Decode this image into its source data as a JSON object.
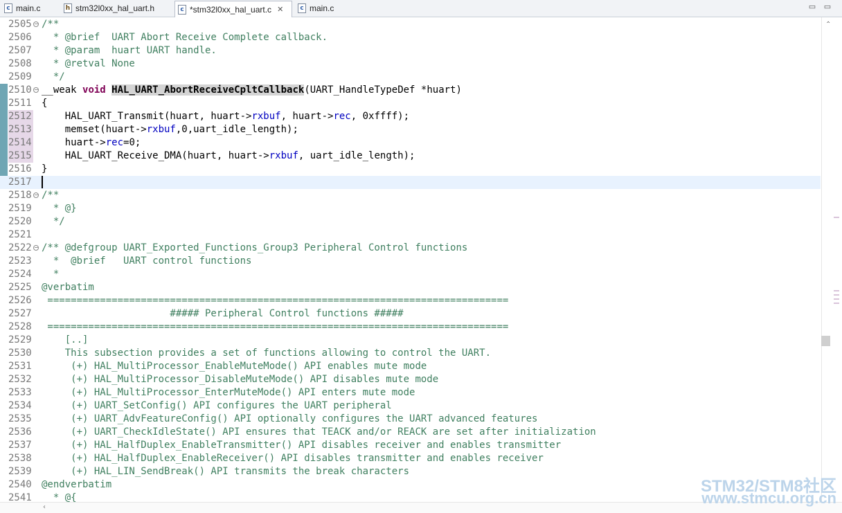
{
  "tabs": [
    {
      "label": "main.c",
      "icon": "c-file-icon",
      "active": false
    },
    {
      "label": "stm32l0xx_hal_uart.h",
      "icon": "h-file-icon",
      "active": false
    },
    {
      "label": "*stm32l0xx_hal_uart.c",
      "icon": "c-file-icon",
      "active": true
    },
    {
      "label": "main.c",
      "icon": "c-file-icon",
      "active": false
    }
  ],
  "window_controls": {
    "minimize": "▭",
    "maximize": "▭"
  },
  "lines": [
    {
      "n": "2505",
      "fold": true,
      "html": "<span class=\"cm\">/**</span>"
    },
    {
      "n": "2506",
      "html": "<span class=\"cm\">  * @brief  UART Abort Receive Complete callback.</span>"
    },
    {
      "n": "2507",
      "html": "<span class=\"cm\">  * @param  huart UART handle.</span>"
    },
    {
      "n": "2508",
      "html": "<span class=\"cm\">  * @retval None</span>"
    },
    {
      "n": "2509",
      "html": "<span class=\"cm\">  */</span>"
    },
    {
      "n": "2510",
      "fold": true,
      "html": "__weak <span class=\"kw\">void</span> <span class=\"hl\">HAL_UART_AbortReceiveCpltCallback</span>(UART_HandleTypeDef *huart)"
    },
    {
      "n": "2511",
      "html": "{"
    },
    {
      "n": "2512",
      "html": "    HAL_UART_Transmit(huart, huart-&gt;<span class=\"fld\">rxbuf</span>, huart-&gt;<span class=\"fld\">rec</span>, 0xffff);"
    },
    {
      "n": "2513",
      "html": "    memset(huart-&gt;<span class=\"fld\">rxbuf</span>,0,uart_idle_length);"
    },
    {
      "n": "2514",
      "html": "    huart-&gt;<span class=\"fld\">rec</span>=0;"
    },
    {
      "n": "2515",
      "html": "    HAL_UART_Receive_DMA(huart, huart-&gt;<span class=\"fld\">rxbuf</span>, uart_idle_length);"
    },
    {
      "n": "2516",
      "html": "}"
    },
    {
      "n": "2517",
      "cur": true,
      "html": "<span class=\"caret\"></span>"
    },
    {
      "n": "2518",
      "fold": true,
      "html": "<span class=\"cm\">/**</span>"
    },
    {
      "n": "2519",
      "html": "<span class=\"cm\">  * @}</span>"
    },
    {
      "n": "2520",
      "html": "<span class=\"cm\">  */</span>"
    },
    {
      "n": "2521",
      "html": ""
    },
    {
      "n": "2522",
      "fold": true,
      "html": "<span class=\"cm\">/** @defgroup UART_Exported_Functions_Group3 Peripheral Control functions</span>"
    },
    {
      "n": "2523",
      "html": "<span class=\"cm\">  *  @brief   UART control functions</span>"
    },
    {
      "n": "2524",
      "html": "<span class=\"cm\">  *</span>"
    },
    {
      "n": "2525",
      "html": "<span class=\"cm\">@verbatim</span>"
    },
    {
      "n": "2526",
      "html": "<span class=\"cm\"> ===============================================================================</span>"
    },
    {
      "n": "2527",
      "html": "<span class=\"cm\">                      ##### Peripheral Control functions #####</span>"
    },
    {
      "n": "2528",
      "html": "<span class=\"cm\"> ===============================================================================</span>"
    },
    {
      "n": "2529",
      "html": "<span class=\"cm\">    [..]</span>"
    },
    {
      "n": "2530",
      "html": "<span class=\"cm\">    This subsection provides a set of functions allowing to control the UART.</span>"
    },
    {
      "n": "2531",
      "html": "<span class=\"cm\">     (+) HAL_MultiProcessor_EnableMuteMode() API enables mute mode</span>"
    },
    {
      "n": "2532",
      "html": "<span class=\"cm\">     (+) HAL_MultiProcessor_DisableMuteMode() API disables mute mode</span>"
    },
    {
      "n": "2533",
      "html": "<span class=\"cm\">     (+) HAL_MultiProcessor_EnterMuteMode() API enters mute mode</span>"
    },
    {
      "n": "2534",
      "html": "<span class=\"cm\">     (+) UART_SetConfig() API configures the UART peripheral</span>"
    },
    {
      "n": "2535",
      "html": "<span class=\"cm\">     (+) UART_AdvFeatureConfig() API optionally configures the UART advanced features</span>"
    },
    {
      "n": "2536",
      "html": "<span class=\"cm\">     (+) UART_CheckIdleState() API ensures that TEACK and/or REACK are set after initialization</span>"
    },
    {
      "n": "2537",
      "html": "<span class=\"cm\">     (+) HAL_HalfDuplex_EnableTransmitter() API disables receiver and enables transmitter</span>"
    },
    {
      "n": "2538",
      "html": "<span class=\"cm\">     (+) HAL_HalfDuplex_EnableReceiver() API disables transmitter and enables receiver</span>"
    },
    {
      "n": "2539",
      "html": "<span class=\"cm\">     (+) HAL_LIN_SendBreak() API transmits the break characters</span>"
    },
    {
      "n": "2540",
      "html": "<span class=\"cm\">@endverbatim</span>"
    },
    {
      "n": "2541",
      "html": "<span class=\"cm\">  * @{</span>"
    }
  ],
  "watermark": {
    "line1": "STM32/STM8社区",
    "line2": "www.stmcu.org.cn"
  }
}
